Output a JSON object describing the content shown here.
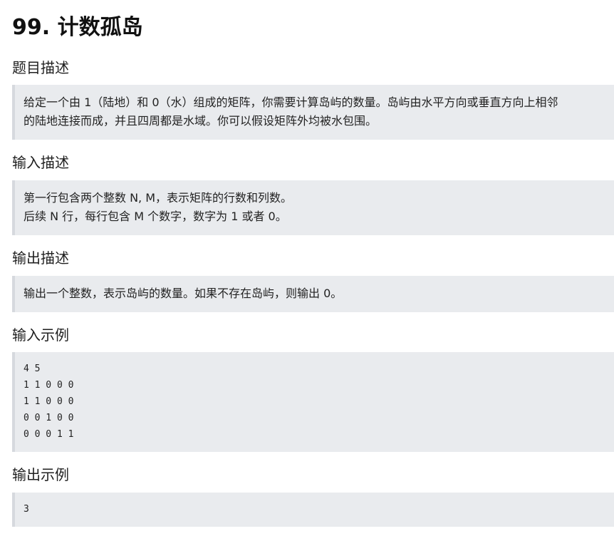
{
  "title": "99. 计数孤岛",
  "sections": {
    "description": {
      "heading": "题目描述",
      "lines": [
        "给定一个由 1（陆地）和 0（水）组成的矩阵，你需要计算岛屿的数量。岛屿由水平方向或垂直方向上相邻",
        "的陆地连接而成，并且四周都是水域。你可以假设矩阵外均被水包围。"
      ]
    },
    "input": {
      "heading": "输入描述",
      "lines": [
        "第一行包含两个整数 N, M，表示矩阵的行数和列数。",
        "后续 N 行，每行包含 M 个数字，数字为 1 或者 0。"
      ]
    },
    "output": {
      "heading": "输出描述",
      "lines": [
        "输出一个整数，表示岛屿的数量。如果不存在岛屿，则输出 0。"
      ]
    },
    "input_example": {
      "heading": "输入示例",
      "lines": [
        "4 5",
        "1 1 0 0 0",
        "1 1 0 0 0",
        "0 0 1 0 0",
        "0 0 0 1 1"
      ]
    },
    "output_example": {
      "heading": "输出示例",
      "lines": [
        "3"
      ]
    }
  }
}
